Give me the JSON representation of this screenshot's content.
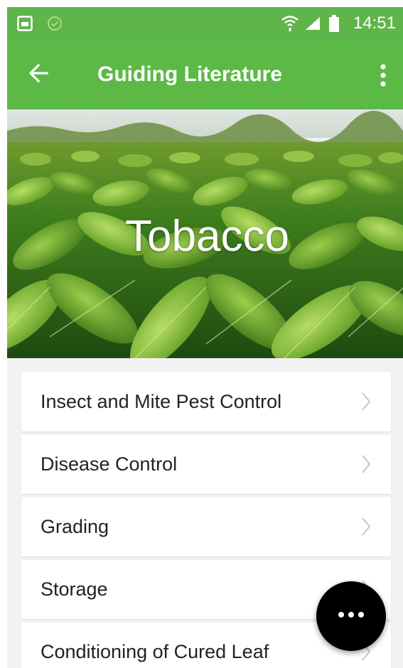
{
  "status_bar": {
    "time": "14:51",
    "icons": [
      "gallery-icon",
      "check-circle-icon",
      "wifi-icon",
      "signal-icon",
      "battery-icon"
    ]
  },
  "app_bar": {
    "title": "Guiding Literature",
    "back_icon": "back-arrow-icon",
    "menu_icon": "more-vert-icon"
  },
  "banner": {
    "label": "Tobacco"
  },
  "items": [
    {
      "label": "Insect and Mite Pest Control"
    },
    {
      "label": "Disease Control"
    },
    {
      "label": "Grading"
    },
    {
      "label": "Storage"
    },
    {
      "label": "Conditioning of Cured Leaf"
    }
  ],
  "fab": {
    "icon": "more-horiz-icon"
  },
  "colors": {
    "primary": "#5cb946",
    "status_bar": "#5fb54a",
    "fab": "#000000",
    "background": "#f2f2f2"
  }
}
